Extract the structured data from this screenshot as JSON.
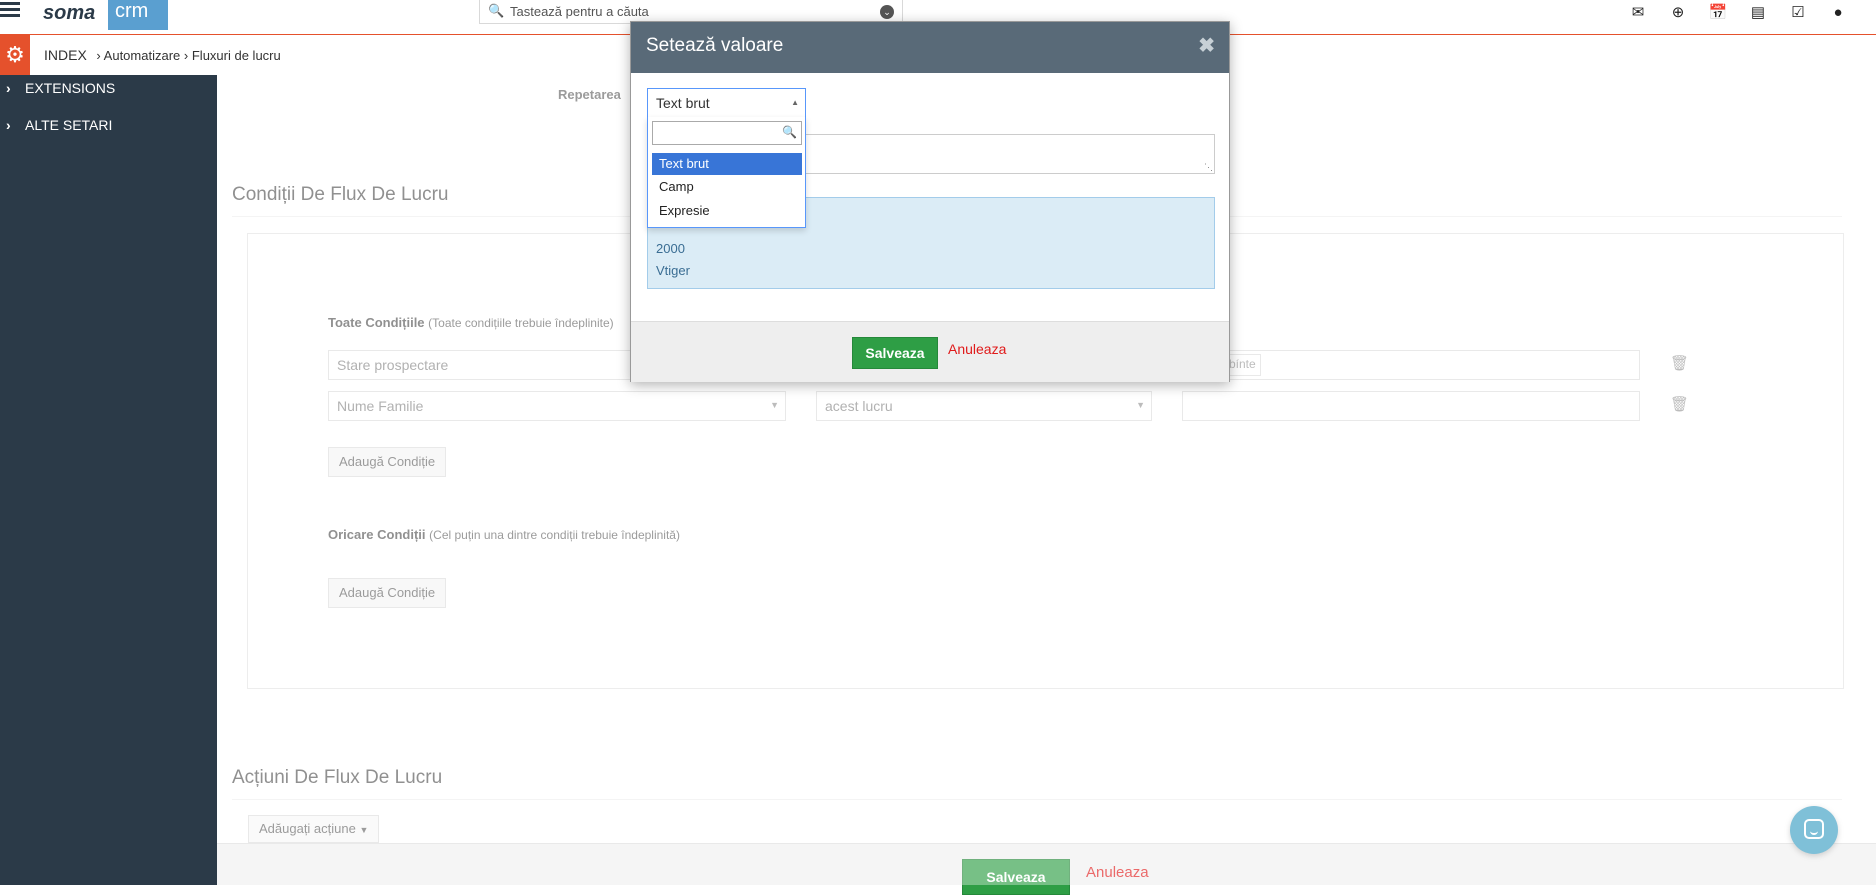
{
  "header": {
    "logo_text_dark": "soma",
    "logo_text_light": "crm",
    "search_placeholder": "Tastează pentru a căuta",
    "icons": [
      "envelope-icon",
      "plus-circle-icon",
      "calendar-icon",
      "bar-chart-icon",
      "checkbox-icon",
      "user-icon"
    ]
  },
  "breadcrumb": {
    "root": "INDEX",
    "level1": "Automatizare",
    "level2": "Fluxuri de lucru"
  },
  "sidebar": {
    "items": [
      {
        "label": "EXTENSIONS"
      },
      {
        "label": "ALTE SETARI"
      }
    ]
  },
  "main": {
    "repetarea_label": "Repetarea",
    "conditions_title": "Condiții De Flux De Lucru",
    "all_conditions_label": "Toate Condițiile",
    "all_conditions_sub": "(Toate condițiile trebuie îndeplinite)",
    "rows": [
      {
        "field": "Stare prospectare",
        "operator": "",
        "value_chip": "bínte"
      },
      {
        "field": "Nume Familie",
        "operator": "acest lucru",
        "value": ""
      }
    ],
    "add_condition_label": "Adaugă Condiție",
    "any_conditions_label": "Oricare Condiții",
    "any_conditions_sub": "(Cel puțin una dintre condiții trebuie îndeplinită)",
    "add_condition_label_2": "Adaugă Condiție",
    "actions_title": "Acțiuni De Flux De Lucru",
    "add_action_label": "Adăugați acțiune"
  },
  "footer": {
    "save_label": "Salveaza",
    "cancel_label": "Anuleaza"
  },
  "modal": {
    "title": "Setează valoare",
    "close_icon": "close-icon",
    "select_value": "Text brut",
    "dropdown_options": [
      "Text brut",
      "Camp",
      "Expresie"
    ],
    "selected_option": "Text brut",
    "list_items": [
      "2000",
      "Vtiger"
    ],
    "save_label": "Salveaza",
    "cancel_label": "Anuleaza"
  },
  "colors": {
    "accent": "#e5512c",
    "sidebar_bg": "#2b3a48",
    "modal_header": "#596a78",
    "save_green": "#2e9e45",
    "cancel_red": "#e01a1a",
    "selected_option": "#3875d7"
  }
}
